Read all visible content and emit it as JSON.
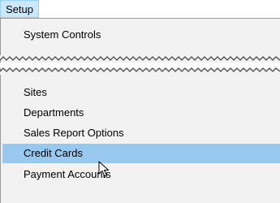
{
  "menubar": {
    "setup_label": "Setup"
  },
  "menu": {
    "top_items": [
      {
        "label": "System Controls"
      }
    ],
    "items": [
      {
        "label": "Sites"
      },
      {
        "label": "Departments"
      },
      {
        "label": "Sales Report Options"
      },
      {
        "label": "Credit Cards",
        "highlighted": true
      },
      {
        "label": "Payment Accounts"
      }
    ]
  },
  "colors": {
    "menu_background": "#f2f2f2",
    "highlight": "#99c9ef",
    "menubar_active": "#cce8ff"
  },
  "icons": {
    "pointer": "arrow-cursor-icon"
  }
}
